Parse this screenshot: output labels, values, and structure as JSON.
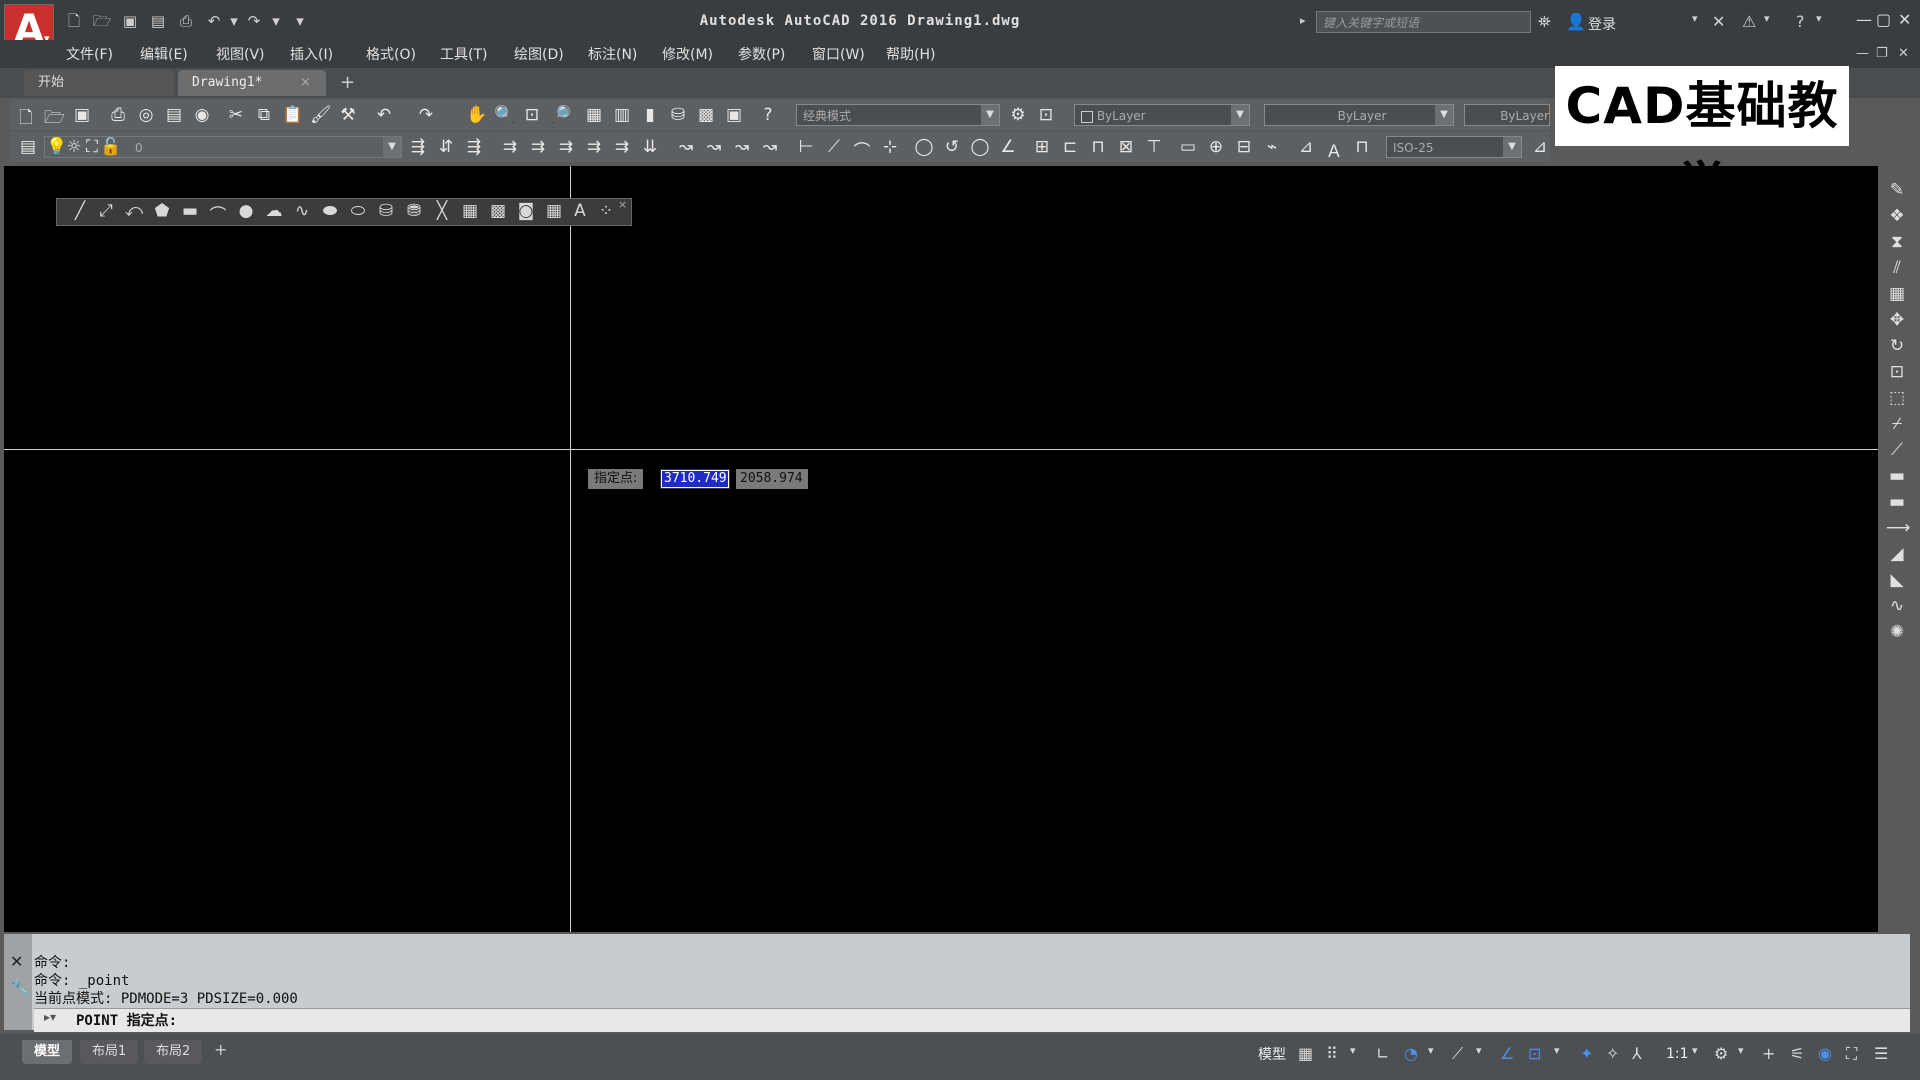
{
  "window": {
    "title": "Autodesk AutoCAD 2016    Drawing1.dwg",
    "search_placeholder": "键入关键字或短语",
    "login": "登录"
  },
  "menu": [
    "文件(F)",
    "编辑(E)",
    "视图(V)",
    "插入(I)",
    "格式(O)",
    "工具(T)",
    "绘图(D)",
    "标注(N)",
    "修改(M)",
    "参数(P)",
    "窗口(W)",
    "帮助(H)"
  ],
  "tabs": {
    "start": "开始",
    "drawing": "Drawing1*",
    "close": "×",
    "add": "+"
  },
  "toolbar": {
    "workspace": "经典模式",
    "color": "ByLayer",
    "linetype": "ByLayer",
    "lineweight": "ByLayer",
    "layer": "0",
    "dimstyle": "ISO-25"
  },
  "watermark": "CAD基础教学",
  "dynamic_input": {
    "prompt": "指定点:",
    "x": "3710.749",
    "y": "2058.974"
  },
  "command": {
    "lines": [
      "命令:",
      "命令: _point",
      "当前点模式:  PDMODE=3  PDSIZE=0.000"
    ],
    "input": "POINT 指定点:"
  },
  "layouts": {
    "model": "模型",
    "layout1": "布局1",
    "layout2": "布局2",
    "add": "+"
  },
  "status": {
    "model": "模型",
    "scale": "1:1"
  },
  "icons": {
    "accent": "#c9302c",
    "selection_highlight": "#1e2bc4"
  }
}
